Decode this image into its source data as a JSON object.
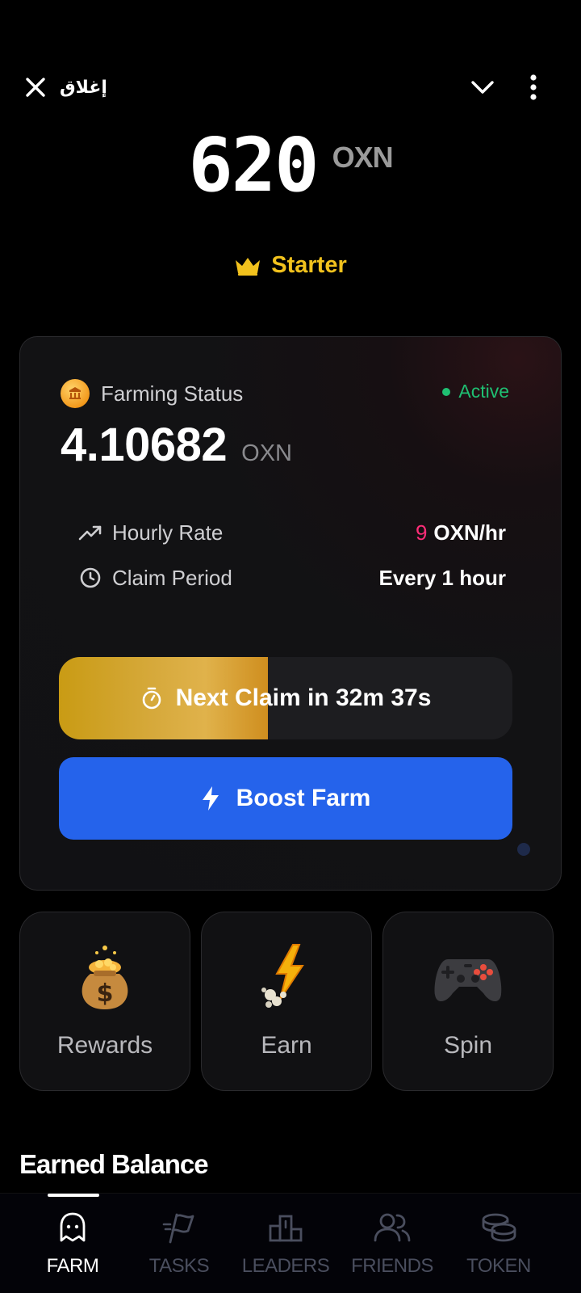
{
  "topbar": {
    "close_label": "إغلاق"
  },
  "balance": {
    "amount": "620",
    "unit": "OXN"
  },
  "tier": {
    "label": "Starter",
    "icon": "crown-icon"
  },
  "farming": {
    "title": "Farming Status",
    "status": "Active",
    "earned_value": "4.10682",
    "earned_unit": "OXN",
    "hourly_rate_label": "Hourly Rate",
    "hourly_rate_number": "9",
    "hourly_rate_unit": "OXN/hr",
    "claim_period_label": "Claim Period",
    "claim_period_value": "Every 1 hour",
    "claim_button_label": "Next Claim in 32m 37s",
    "claim_progress": 0.46,
    "boost_button_label": "Boost Farm"
  },
  "tiles": [
    {
      "label": "Rewards",
      "icon": "money-bag-icon"
    },
    {
      "label": "Earn",
      "icon": "lightning-icon"
    },
    {
      "label": "Spin",
      "icon": "gamepad-icon"
    }
  ],
  "section": {
    "earned_balance_title": "Earned Balance"
  },
  "nav": {
    "items": [
      {
        "label": "FARM",
        "icon": "ghost-icon",
        "active": true
      },
      {
        "label": "TASKS",
        "icon": "flag-icon",
        "active": false
      },
      {
        "label": "LEADERS",
        "icon": "podium-icon",
        "active": false
      },
      {
        "label": "FRIENDS",
        "icon": "users-icon",
        "active": false
      },
      {
        "label": "TOKEN",
        "icon": "coins-icon",
        "active": false
      }
    ]
  },
  "colors": {
    "accent_gold": "#f2c21d",
    "active_green": "#1fbf72",
    "boost_blue": "#2563eb",
    "rate_pink": "#ff2d78"
  }
}
